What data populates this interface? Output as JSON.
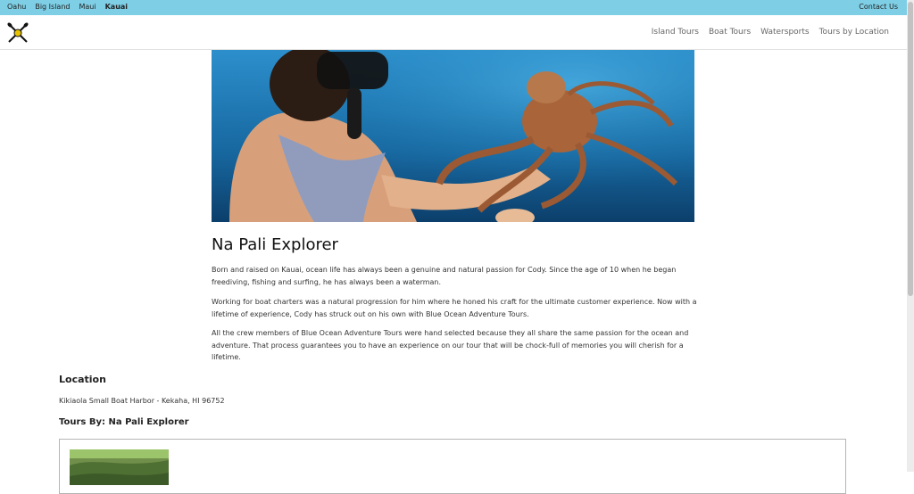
{
  "top_bar": {
    "islands": [
      "Oahu",
      "Big Island",
      "Maui",
      "Kauai"
    ],
    "active_island": "Kauai",
    "contact_label": "Contact Us"
  },
  "nav": {
    "items": [
      "Island Tours",
      "Boat Tours",
      "Watersports",
      "Tours by Location"
    ]
  },
  "page": {
    "title": "Na Pali Explorer",
    "paragraphs": [
      "Born and raised on Kauai, ocean life has always been a genuine and natural passion for Cody. Since the age of 10 when he began freediving, fishing and surfing, he has always been a waterman.",
      "Working for boat charters was a natural progression for him where he honed his craft for the ultimate customer experience. Now with a lifetime of experience, Cody has struck out on his own with Blue Ocean Adventure Tours.",
      "All the crew members of Blue Ocean Adventure Tours were hand selected because they all share the same passion for the ocean and adventure. That process guarantees you to have an experience on our tour that will be chock-full of memories you will cherish for a lifetime."
    ]
  },
  "location": {
    "heading": "Location",
    "address": "Kikiaola Small Boat Harbor - Kekaha, HI 96752"
  },
  "tours": {
    "heading": "Tours By: Na Pali Explorer"
  },
  "icons": {
    "logo": "crossed-paddles-icon"
  },
  "colors": {
    "top_bar": "#7ecfe6",
    "ocean": "#1f7fb8",
    "octopus": "#a9643a"
  }
}
